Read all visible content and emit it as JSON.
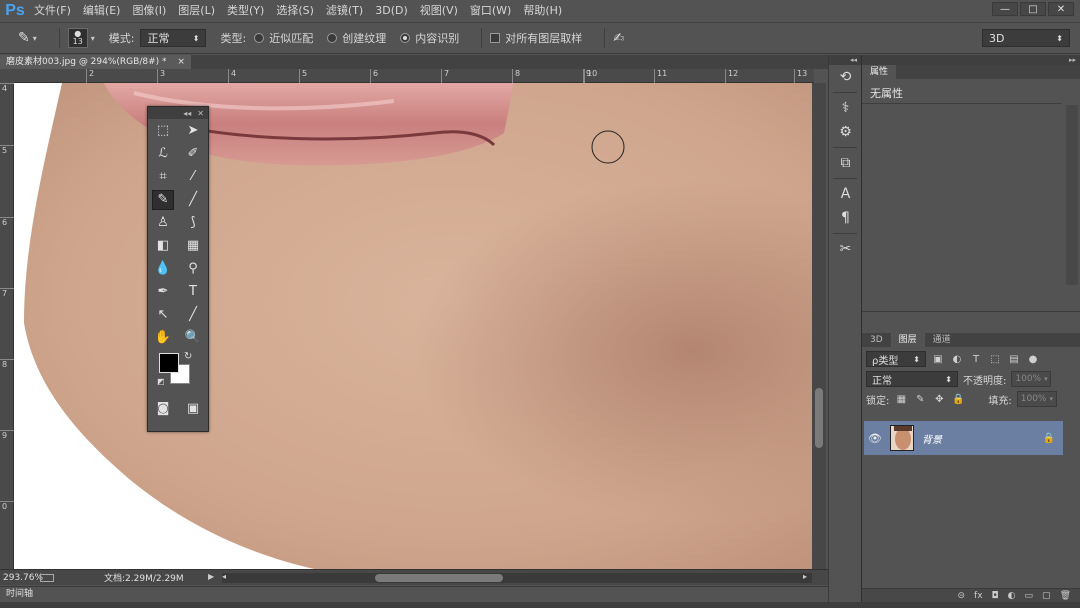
{
  "app": {
    "logo": "Ps",
    "menu": [
      "文件(F)",
      "编辑(E)",
      "图像(I)",
      "图层(L)",
      "类型(Y)",
      "选择(S)",
      "滤镜(T)",
      "3D(D)",
      "视图(V)",
      "窗口(W)",
      "帮助(H)"
    ],
    "window_controls": [
      "—",
      "□",
      "✕"
    ]
  },
  "options": {
    "brush_size": "13",
    "mode_label": "模式:",
    "mode_value": "正常",
    "type_label": "类型:",
    "type_options": [
      "近似匹配",
      "创建纹理",
      "内容识别"
    ],
    "type_selected": "内容识别",
    "sample_all_label": "对所有图层取样",
    "workspace": "3D"
  },
  "document": {
    "tab_title": "磨皮素材003.jpg @ 294%(RGB/8#) *",
    "tab_close": "×",
    "hruler_ticks": [
      "2",
      "3",
      "4",
      "5",
      "6",
      "7",
      "8",
      "9",
      "10",
      "11",
      "12",
      "13"
    ],
    "vruler_ticks": [
      "4",
      "5",
      "6",
      "7",
      "8",
      "9",
      "0"
    ]
  },
  "status": {
    "zoom": "293.76%",
    "doc_info": "文档:2.29M/2.29M"
  },
  "timeline": {
    "label": "时间轴"
  },
  "tools": {
    "header_icons": [
      "◂◂",
      "✕"
    ]
  },
  "properties": {
    "tab": "属性",
    "empty_text": "无属性"
  },
  "layers": {
    "tabs": [
      "3D",
      "图层",
      "通道"
    ],
    "active_tab": "图层",
    "filter_label": "ρ类型",
    "blend_mode": "正常",
    "opacity_label": "不透明度:",
    "opacity_value": "100%",
    "lock_label": "锁定:",
    "fill_label": "填充:",
    "fill_value": "100%",
    "items": [
      {
        "name": "背景",
        "visible": true,
        "locked": true
      }
    ],
    "footer_icons": [
      "⊝",
      "fx",
      "◘",
      "◐",
      "▭",
      "▢",
      "🗑"
    ]
  },
  "colors": {
    "foreground": "#000000",
    "background": "#ffffff",
    "selected_layer": "#6b7fa3",
    "ps_blue": "#4aa3f0"
  }
}
